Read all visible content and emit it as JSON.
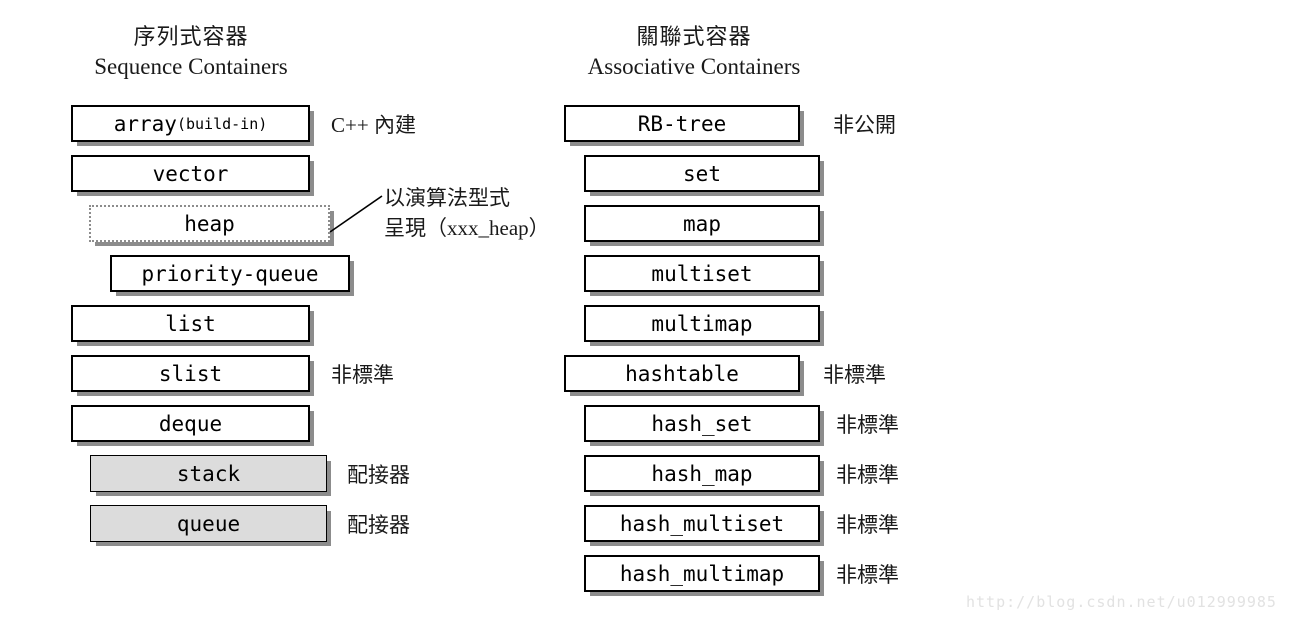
{
  "columns": [
    {
      "id": "sequence",
      "heading_cjk": "序列式容器",
      "heading_latin": "Sequence Containers",
      "boxes": [
        {
          "label": "array",
          "suffix": "(build-in)",
          "note": "C++ 內建",
          "style": "solid"
        },
        {
          "label": "vector",
          "suffix": "",
          "note": "",
          "style": "solid"
        },
        {
          "label": "heap",
          "suffix": "",
          "note": "",
          "style": "dotted"
        },
        {
          "label": "priority-queue",
          "suffix": "",
          "note": "",
          "style": "solid"
        },
        {
          "label": "list",
          "suffix": "",
          "note": "",
          "style": "solid"
        },
        {
          "label": "slist",
          "suffix": "",
          "note": "非標準",
          "style": "solid"
        },
        {
          "label": "deque",
          "suffix": "",
          "note": "",
          "style": "solid"
        },
        {
          "label": "stack",
          "suffix": "",
          "note": "配接器",
          "style": "gray"
        },
        {
          "label": "queue",
          "suffix": "",
          "note": "配接器",
          "style": "gray"
        }
      ]
    },
    {
      "id": "associative",
      "heading_cjk": "關聯式容器",
      "heading_latin": "Associative Containers",
      "boxes": [
        {
          "label": "RB-tree",
          "suffix": "",
          "note": "非公開",
          "style": "solid"
        },
        {
          "label": "set",
          "suffix": "",
          "note": "",
          "style": "solid"
        },
        {
          "label": "map",
          "suffix": "",
          "note": "",
          "style": "solid"
        },
        {
          "label": "multiset",
          "suffix": "",
          "note": "",
          "style": "solid"
        },
        {
          "label": "multimap",
          "suffix": "",
          "note": "",
          "style": "solid"
        },
        {
          "label": "hashtable",
          "suffix": "",
          "note": "非標準",
          "style": "solid"
        },
        {
          "label": "hash_set",
          "suffix": "",
          "note": "非標準",
          "style": "solid"
        },
        {
          "label": "hash_map",
          "suffix": "",
          "note": "非標準",
          "style": "solid"
        },
        {
          "label": "hash_multiset",
          "suffix": "",
          "note": "非標準",
          "style": "solid"
        },
        {
          "label": "hash_multimap",
          "suffix": "",
          "note": "非標準",
          "style": "solid"
        }
      ]
    }
  ],
  "heap_annotation": {
    "line1": "以演算法型式",
    "line2": "呈現（xxx_heap）"
  },
  "watermark": "http://blog.csdn.net/u012999985",
  "colors": {
    "box_border": "#000000",
    "box_fill": "#ffffff",
    "adapter_fill": "#dcdcdc",
    "shadow": "#787878",
    "text": "#000000",
    "watermark": "#e2e2e2",
    "dotted_border": "#8c8c8c"
  }
}
